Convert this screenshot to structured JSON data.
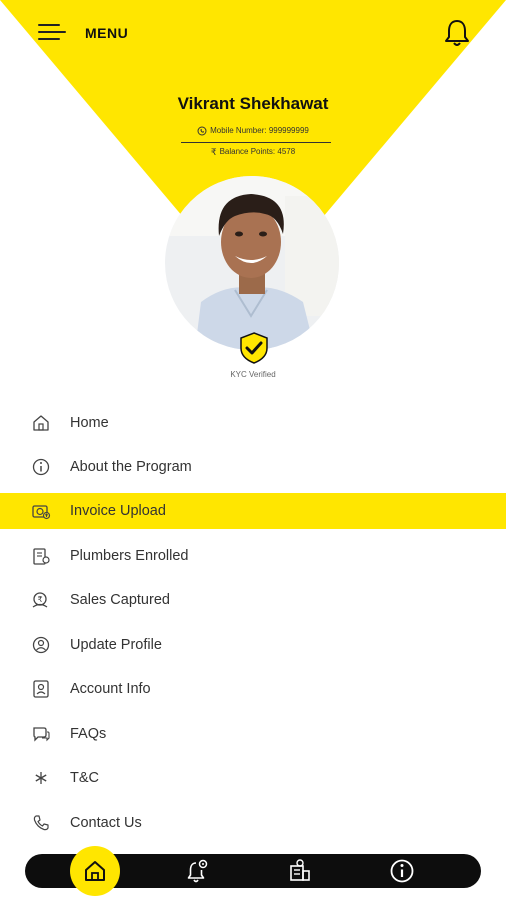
{
  "header": {
    "menu_label": "MENU",
    "menu_icon": "hamburger-icon",
    "notification_icon": "bell-icon"
  },
  "profile": {
    "name": "Vikrant Shekhawat",
    "mobile": "Mobile Number: 999999999",
    "balance": "Balance Points: 4578",
    "kyc_status": "KYC Verified"
  },
  "menu": {
    "items": [
      {
        "label": "Home",
        "icon": "home-icon"
      },
      {
        "label": "About the Program",
        "icon": "info-icon"
      },
      {
        "label": "Invoice Upload",
        "icon": "invoice-upload-icon",
        "active": true
      },
      {
        "label": "Plumbers Enrolled",
        "icon": "plumbers-icon"
      },
      {
        "label": "Sales Captured",
        "icon": "sales-icon"
      },
      {
        "label": "Update Profile",
        "icon": "profile-icon"
      },
      {
        "label": "Account Info",
        "icon": "account-icon"
      },
      {
        "label": "FAQs",
        "icon": "faq-icon"
      },
      {
        "label": "T&C",
        "icon": "terms-icon"
      },
      {
        "label": "Contact Us",
        "icon": "contact-icon"
      }
    ]
  },
  "bottom_nav": {
    "items": [
      "home-icon",
      "notification-settings-icon",
      "sales-building-icon",
      "info-icon"
    ]
  },
  "colors": {
    "accent": "#ffe600",
    "dark": "#0d0d0d"
  }
}
